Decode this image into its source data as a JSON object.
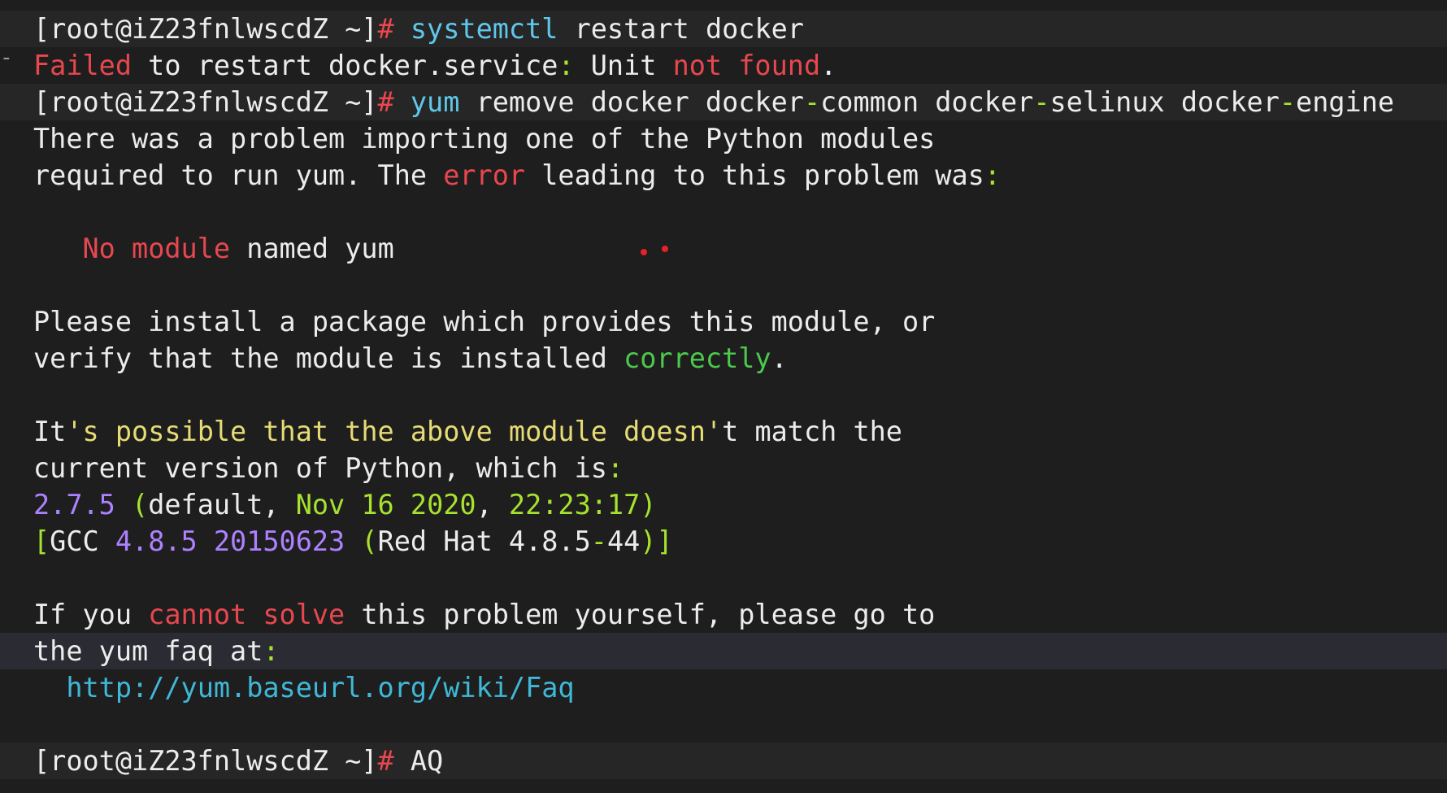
{
  "colors": {
    "background": "#1e1e1e",
    "text": "#ececec",
    "red": "#e8474f",
    "cyan": "#5fc8ea",
    "lime": "#a6e22e",
    "yellow": "#e6db74",
    "purple": "#ae81ff",
    "green": "#4cc94c"
  },
  "gutter": {
    "fold_1": "⊟",
    "dash_1": "-",
    "fold_2": "⊟",
    "dash_2": "-"
  },
  "terminal": {
    "l1": {
      "prompt": "[root@iZ23fnlwscdZ ~]",
      "hash": "#",
      "sp": " ",
      "cmd": "systemctl",
      "rest": " restart docker"
    },
    "l2": {
      "failed": "Failed",
      "a": " to restart docker.service",
      "colon": ":",
      "b": " Unit ",
      "notfound": "not found",
      "dot": "."
    },
    "l3": {
      "prompt": "[root@iZ23fnlwscdZ ~]",
      "hash": "#",
      "sp": " ",
      "cmd": "yum",
      "a": " remove docker docker",
      "d1": "-",
      "b": "common docker",
      "d2": "-",
      "c": "selinux docker",
      "d3": "-",
      "e": "engine"
    },
    "l4": {
      "text": "There was a problem importing one of the Python modules"
    },
    "l5": {
      "a": "required to run yum. The ",
      "error": "error",
      "b": " leading to this problem was",
      "colon": ":"
    },
    "l6": {
      "text": ""
    },
    "l7": {
      "indent": "   ",
      "nomodule": "No module",
      "rest": " named yum"
    },
    "l8": {
      "text": ""
    },
    "l9": {
      "text": "Please install a package which provides this module, or"
    },
    "l10": {
      "a": "verify that the module is installed ",
      "correctly": "correctly",
      "dot": "."
    },
    "l11": {
      "text": ""
    },
    "l12": {
      "a": "It",
      "q1": "'",
      "yellow": "s possible that the above module doesn",
      "q2": "'",
      "b": "t match the"
    },
    "l13": {
      "a": "current version of Python, which is",
      "colon": ":"
    },
    "l14": {
      "ver": "2.7.5",
      "sp1": " ",
      "p1": "(",
      "def": "default, ",
      "date": "Nov 16 2020",
      "comma": ", ",
      "time": "22:23:17",
      "p2": ")"
    },
    "l15": {
      "b1": "[",
      "gcc": "GCC ",
      "v": "4.8.5 20150623",
      "sp": " ",
      "p1": "(",
      "rh": "Red Hat 4.8.5",
      "dash": "-",
      "num": "44",
      "p2": ")",
      "b2": "]"
    },
    "l16": {
      "text": ""
    },
    "l17": {
      "a": "If you ",
      "cannot": "cannot solve",
      "b": " this problem yourself, please go to"
    },
    "l18": {
      "a": "the yum faq at",
      "colon": ":"
    },
    "l19": {
      "indent": "  ",
      "url": "http://yum.baseurl.org/wiki/Faq"
    },
    "l20": {
      "text": ""
    },
    "l21": {
      "prompt": "[root@iZ23fnlwscdZ ~]",
      "hash": "#",
      "sp": " ",
      "cmd": "AQ"
    }
  }
}
